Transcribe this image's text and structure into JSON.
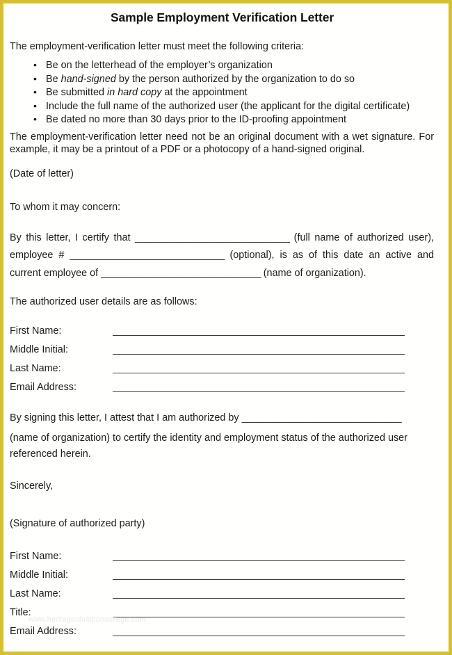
{
  "document": {
    "title": "Sample Employment Verification Letter",
    "border_color": "#d6c02f",
    "text_color": "#1b1b1b",
    "intro": "The employment-verification letter must meet the following criteria:",
    "criteria": [
      {
        "pre": "Be on the letterhead of the employer’s organization",
        "em": "",
        "post": ""
      },
      {
        "pre": "Be ",
        "em": "hand-signed",
        "post": " by the person authorized by the organization to do so"
      },
      {
        "pre": "Be submitted ",
        "em": "in hard copy",
        "post": " at the appointment"
      },
      {
        "pre": "Include the full name of the authorized user (the applicant for the digital certificate)",
        "em": "",
        "post": ""
      },
      {
        "pre": "Be dated no more than 30 days prior to the ID-proofing appointment",
        "em": "",
        "post": ""
      }
    ],
    "note_paragraph": "The employment-verification letter need not be an original document with a wet signature. For example, it may be a printout of a PDF or a photocopy of a hand-signed original.",
    "date_placeholder": "(Date of letter)",
    "salutation": "To whom it may concern:",
    "certify": {
      "part1": "By this letter, I certify that ",
      "blank1": "______________________________",
      "part2": " (full name of authorized user), employee # ",
      "blank2": "______________________________",
      "part3": " (optional), is as of this date an active and current employee of ",
      "blank3": "_______________________________",
      "part4": " (name of organization)."
    },
    "details_heading": "The authorized user details are as follows:",
    "user_fields": [
      {
        "label": "First Name:",
        "value": ""
      },
      {
        "label": "Middle Initial:",
        "value": ""
      },
      {
        "label": "Last Name:",
        "value": ""
      },
      {
        "label": "Email Address:",
        "value": ""
      }
    ],
    "attest": {
      "part1": "By signing this letter, I attest that I am authorized by ",
      "blank": "_______________________________",
      "part2": "(name of organization) to certify the identity and employment status of the authorized user referenced herein."
    },
    "closing": "Sincerely,",
    "signature_placeholder": "(Signature of authorized party)",
    "signer_fields": [
      {
        "label": "First Name:",
        "value": ""
      },
      {
        "label": "Middle Initial:",
        "value": ""
      },
      {
        "label": "Last Name:",
        "value": ""
      },
      {
        "label": "Title:",
        "value": ""
      },
      {
        "label": "Email Address:",
        "value": ""
      }
    ],
    "watermark": "www.heritagechristiancollege.com"
  }
}
